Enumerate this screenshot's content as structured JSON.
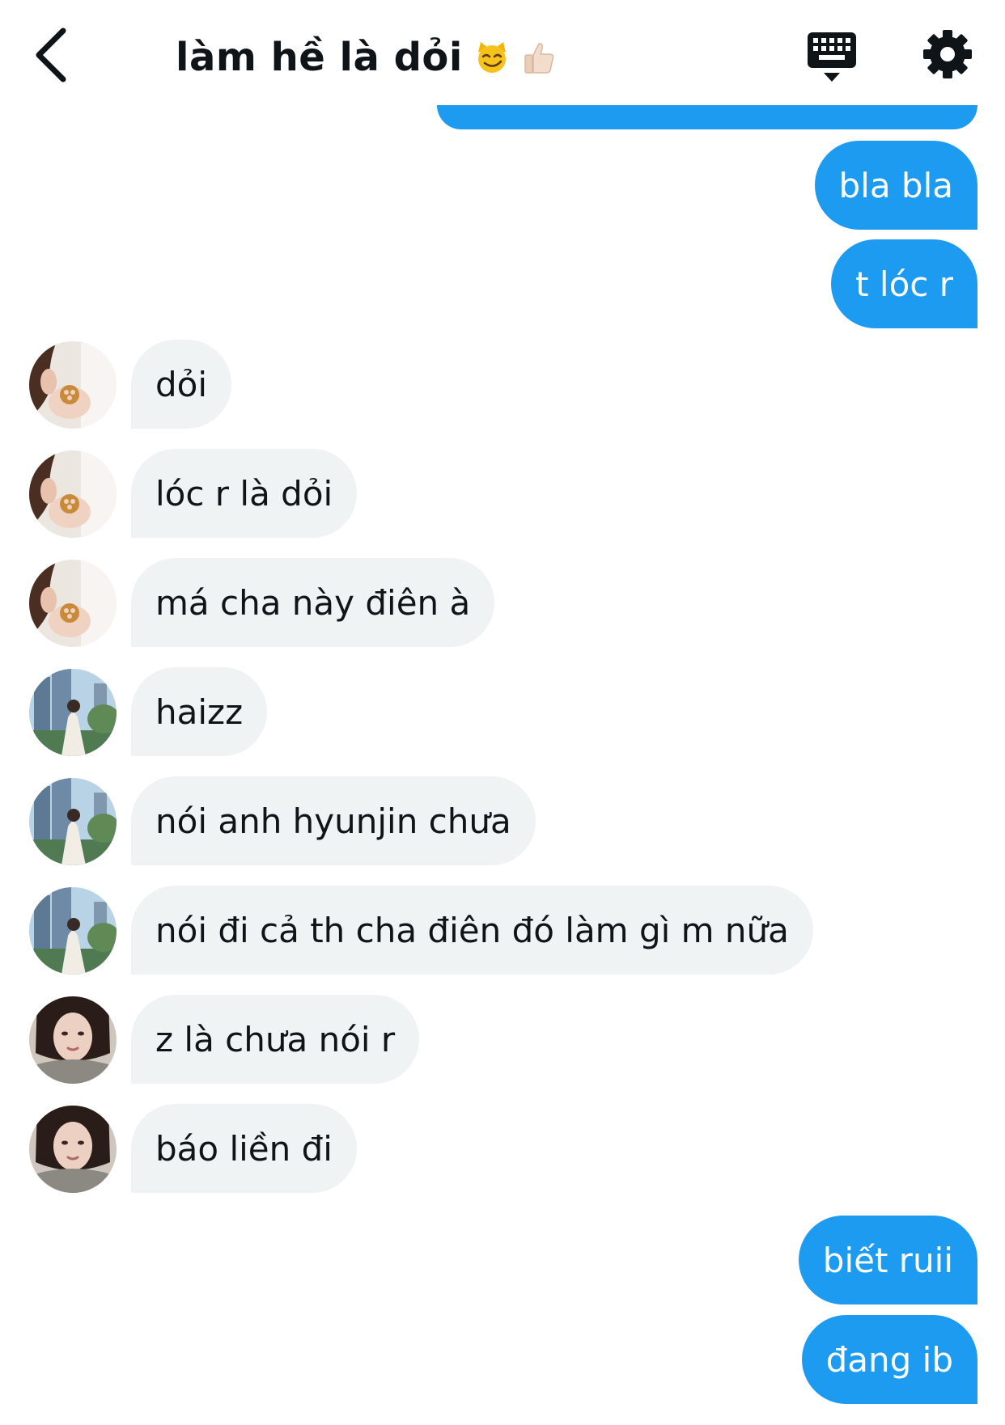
{
  "header": {
    "title": "làm hề là dỏi",
    "emoji_1": "smirking-cat-emoji",
    "emoji_2": "thumbs-up-emoji",
    "icons": [
      "chevron-left-icon",
      "keyboard-icon",
      "gear-icon"
    ]
  },
  "colors": {
    "outgoing_bubble": "#1d9bf0",
    "incoming_bubble": "#eff3f4",
    "text": "#0f1419"
  },
  "messages": [
    {
      "dir": "out",
      "text": "bla bla"
    },
    {
      "dir": "out",
      "text": "t lóc r"
    },
    {
      "dir": "in",
      "avatar": "avatar-pretzel",
      "text": "dỏi"
    },
    {
      "dir": "in",
      "avatar": "avatar-pretzel",
      "text": "lóc r là dỏi"
    },
    {
      "dir": "in",
      "avatar": "avatar-pretzel",
      "text": "má cha này điên à"
    },
    {
      "dir": "in",
      "avatar": "avatar-city",
      "text": "haizz"
    },
    {
      "dir": "in",
      "avatar": "avatar-city",
      "text": "nói anh hyunjin chưa"
    },
    {
      "dir": "in",
      "avatar": "avatar-city",
      "text": "nói đi cả th cha điên đó làm gì m nữa"
    },
    {
      "dir": "in",
      "avatar": "avatar-portrait",
      "text": "z là chưa nói r"
    },
    {
      "dir": "in",
      "avatar": "avatar-portrait",
      "text": "báo liền đi"
    },
    {
      "dir": "out",
      "text": "biết ruii"
    },
    {
      "dir": "out",
      "text": "đang ib"
    }
  ]
}
